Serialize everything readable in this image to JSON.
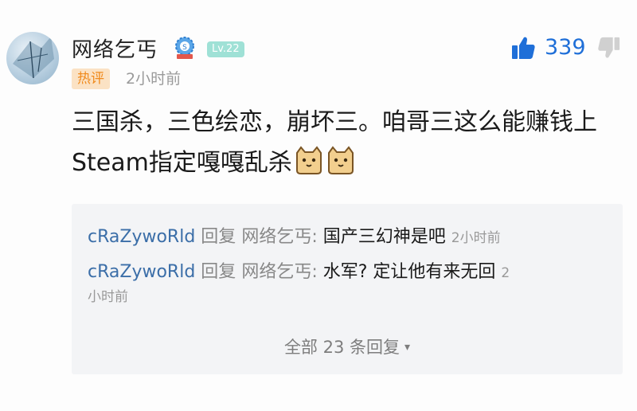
{
  "comment": {
    "username": "网络乞丐",
    "level": "Lv.22",
    "hot_tag": "热评",
    "time": "2小时前",
    "likes": "339",
    "content_line1": "三国杀，三色绘恋，崩坏三。咱哥三这么能赚钱上",
    "content_line2": "Steam指定嘎嘎乱杀"
  },
  "replies": [
    {
      "user": "cRaZywoRld",
      "reply_word": "回复",
      "target": "网络乞丐:",
      "text": "国产三幻神是吧",
      "time": "2小时前"
    },
    {
      "user": "cRaZywoRld",
      "reply_word": "回复",
      "target": "网络乞丐:",
      "text": "水军? 定让他有来无回",
      "time_part1": "2",
      "time_part2": "小时前"
    }
  ],
  "all_replies": {
    "label": "全部 23 条回复",
    "caret": "▾"
  },
  "colors": {
    "like_blue": "#1f6fd8",
    "username_blue": "#3b6ea8",
    "hot_tag_orange": "#f08a1c",
    "level_teal": "#9fe1d6"
  },
  "icons": [
    "avatar",
    "badge-icon",
    "like-icon",
    "dislike-icon",
    "cat-emoji-icon"
  ]
}
